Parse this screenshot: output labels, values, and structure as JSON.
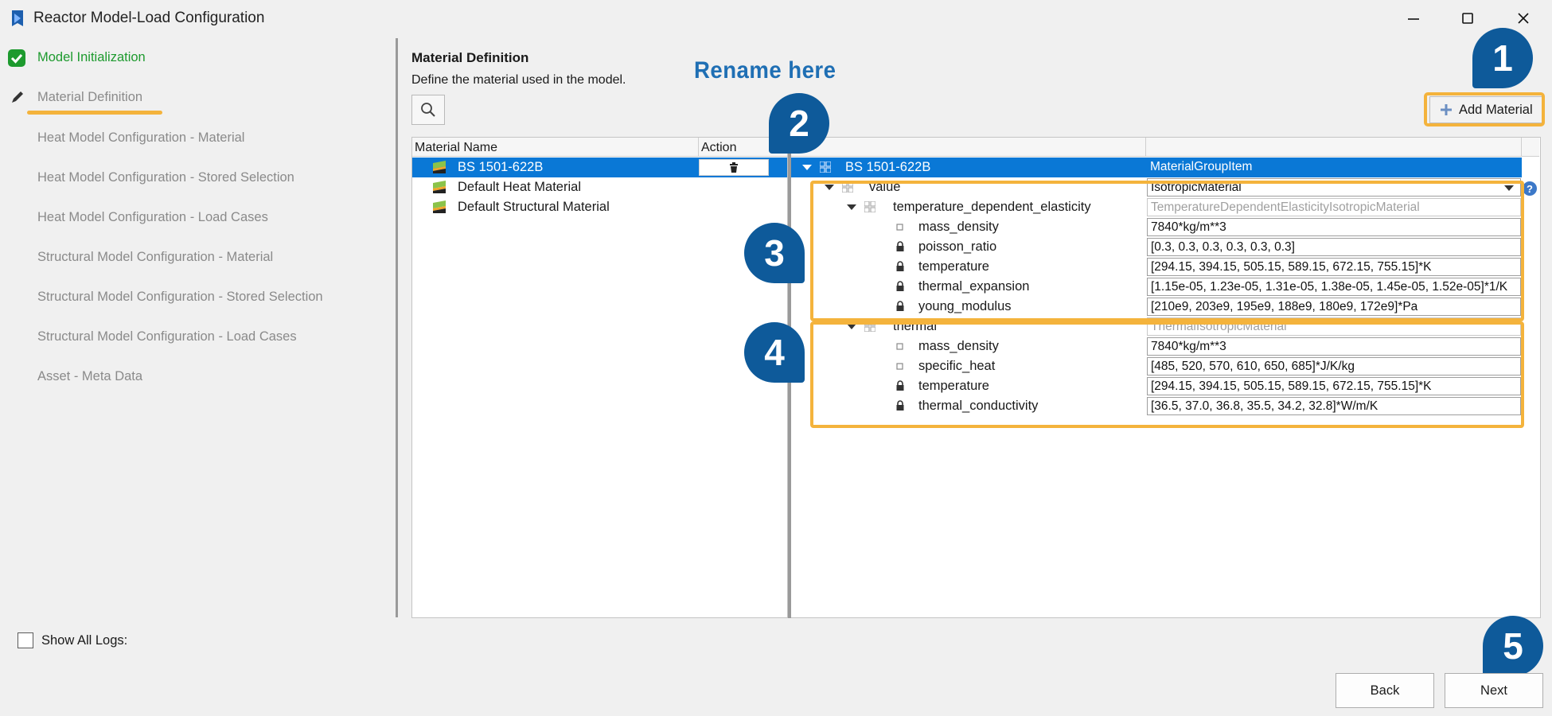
{
  "window": {
    "title": "Reactor Model-Load Configuration",
    "icon": "app-logo-icon",
    "controls": [
      "minimize-icon",
      "maximize-icon",
      "close-icon"
    ]
  },
  "nav": {
    "items": [
      {
        "label": "Model Initialization",
        "state": "done"
      },
      {
        "label": "Material Definition",
        "state": "current"
      },
      {
        "label": "Heat Model Configuration - Material",
        "state": "pending"
      },
      {
        "label": "Heat Model Configuration - Stored Selection",
        "state": "pending"
      },
      {
        "label": "Heat Model Configuration - Load Cases",
        "state": "pending"
      },
      {
        "label": "Structural Model Configuration - Material",
        "state": "pending"
      },
      {
        "label": "Structural Model Configuration - Stored Selection",
        "state": "pending"
      },
      {
        "label": "Structural Model Configuration - Load Cases",
        "state": "pending"
      },
      {
        "label": "Asset - Meta Data",
        "state": "pending"
      }
    ],
    "colors": {
      "done": "#1d9a2e",
      "pending": "#8a8a8a",
      "highlight": "#f4b33c"
    }
  },
  "section": {
    "title": "Material Definition",
    "description": "Define the material used in the model."
  },
  "callouts": {
    "rename": "Rename here",
    "badges": [
      "1",
      "2",
      "3",
      "4",
      "5"
    ],
    "badge_color": "#0e5a9a",
    "outline_color": "#f4b33c"
  },
  "toolbar": {
    "add_material_label": "Add Material"
  },
  "material_list": {
    "columns": [
      "Material Name",
      "Action"
    ],
    "rows": [
      {
        "name": "BS 1501-622B",
        "selected": true
      },
      {
        "name": "Default Heat Material",
        "selected": false
      },
      {
        "name": "Default Structural Material",
        "selected": false
      }
    ]
  },
  "tree": {
    "root": {
      "label": "BS 1501-622B",
      "value": "MaterialGroupItem"
    },
    "value_node": {
      "label": "value",
      "value": "IsotropicMaterial"
    },
    "elasticity": {
      "label": "temperature_dependent_elasticity",
      "value": "TemperatureDependentElasticityIsotropicMaterial",
      "props": [
        {
          "label": "mass_density",
          "value": "7840*kg/m**3",
          "locked": false
        },
        {
          "label": "poisson_ratio",
          "value": "[0.3, 0.3, 0.3, 0.3, 0.3, 0.3]",
          "locked": true
        },
        {
          "label": "temperature",
          "value": "[294.15, 394.15, 505.15, 589.15, 672.15, 755.15]*K",
          "locked": true
        },
        {
          "label": "thermal_expansion",
          "value": "[1.15e-05, 1.23e-05, 1.31e-05, 1.38e-05, 1.45e-05, 1.52e-05]*1/K",
          "locked": true
        },
        {
          "label": "young_modulus",
          "value": "[210e9, 203e9, 195e9, 188e9, 180e9, 172e9]*Pa",
          "locked": true
        }
      ]
    },
    "thermal": {
      "label": "thermal",
      "value": "ThermalIsotropicMaterial",
      "props": [
        {
          "label": "mass_density",
          "value": "7840*kg/m**3",
          "locked": false
        },
        {
          "label": "specific_heat",
          "value": "[485, 520, 570, 610, 650, 685]*J/K/kg",
          "locked": false
        },
        {
          "label": "temperature",
          "value": "[294.15, 394.15, 505.15, 589.15, 672.15, 755.15]*K",
          "locked": true
        },
        {
          "label": "thermal_conductivity",
          "value": "[36.5, 37.0, 36.8, 35.5, 34.2, 32.8]*W/m/K",
          "locked": true
        }
      ]
    }
  },
  "footer": {
    "show_logs_label": "Show All Logs:",
    "back_label": "Back",
    "next_label": "Next"
  },
  "colors": {
    "selection": "#0a78d6"
  }
}
